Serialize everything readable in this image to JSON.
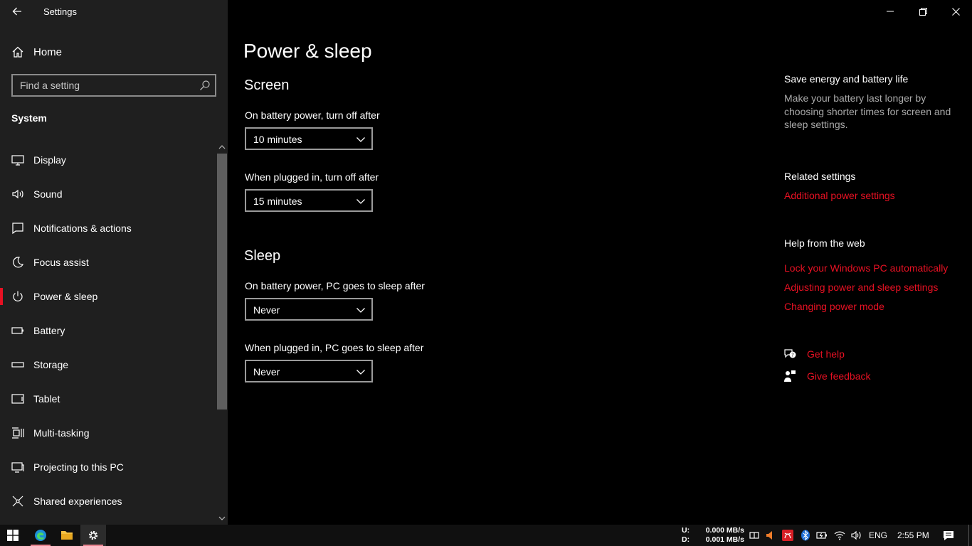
{
  "window": {
    "title": "Settings"
  },
  "sidebar": {
    "home_label": "Home",
    "search_placeholder": "Find a setting",
    "section": "System",
    "items": [
      {
        "label": "Display",
        "icon": "display-icon"
      },
      {
        "label": "Sound",
        "icon": "sound-icon"
      },
      {
        "label": "Notifications & actions",
        "icon": "notifications-icon"
      },
      {
        "label": "Focus assist",
        "icon": "moon-icon"
      },
      {
        "label": "Power & sleep",
        "icon": "power-icon",
        "active": true
      },
      {
        "label": "Battery",
        "icon": "battery-icon"
      },
      {
        "label": "Storage",
        "icon": "storage-icon"
      },
      {
        "label": "Tablet",
        "icon": "tablet-icon"
      },
      {
        "label": "Multi-tasking",
        "icon": "multitasking-icon"
      },
      {
        "label": "Projecting to this PC",
        "icon": "projecting-icon"
      },
      {
        "label": "Shared experiences",
        "icon": "shared-experiences-icon"
      }
    ]
  },
  "main": {
    "title": "Power & sleep",
    "screen": {
      "heading": "Screen",
      "battery_label": "On battery power, turn off after",
      "battery_value": "10 minutes",
      "plugged_label": "When plugged in, turn off after",
      "plugged_value": "15 minutes"
    },
    "sleep": {
      "heading": "Sleep",
      "battery_label": "On battery power, PC goes to sleep after",
      "battery_value": "Never",
      "plugged_label": "When plugged in, PC goes to sleep after",
      "plugged_value": "Never"
    }
  },
  "right": {
    "save_heading": "Save energy and battery life",
    "save_text": "Make your battery last longer by choosing shorter times for screen and sleep settings.",
    "related_heading": "Related settings",
    "related_link": "Additional power settings",
    "help_heading": "Help from the web",
    "help_links": [
      "Lock your Windows PC automatically",
      "Adjusting power and sleep settings",
      "Changing power mode"
    ],
    "get_help": "Get help",
    "give_feedback": "Give feedback"
  },
  "taskbar": {
    "upload_key": "U:",
    "upload_value": "0.000 MB/s",
    "download_key": "D:",
    "download_value": "0.001 MB/s",
    "language": "ENG",
    "time": "2:55 PM"
  },
  "colors": {
    "accent": "#e81123",
    "sidebar_bg": "#1f1f1f",
    "main_bg": "#000000"
  }
}
